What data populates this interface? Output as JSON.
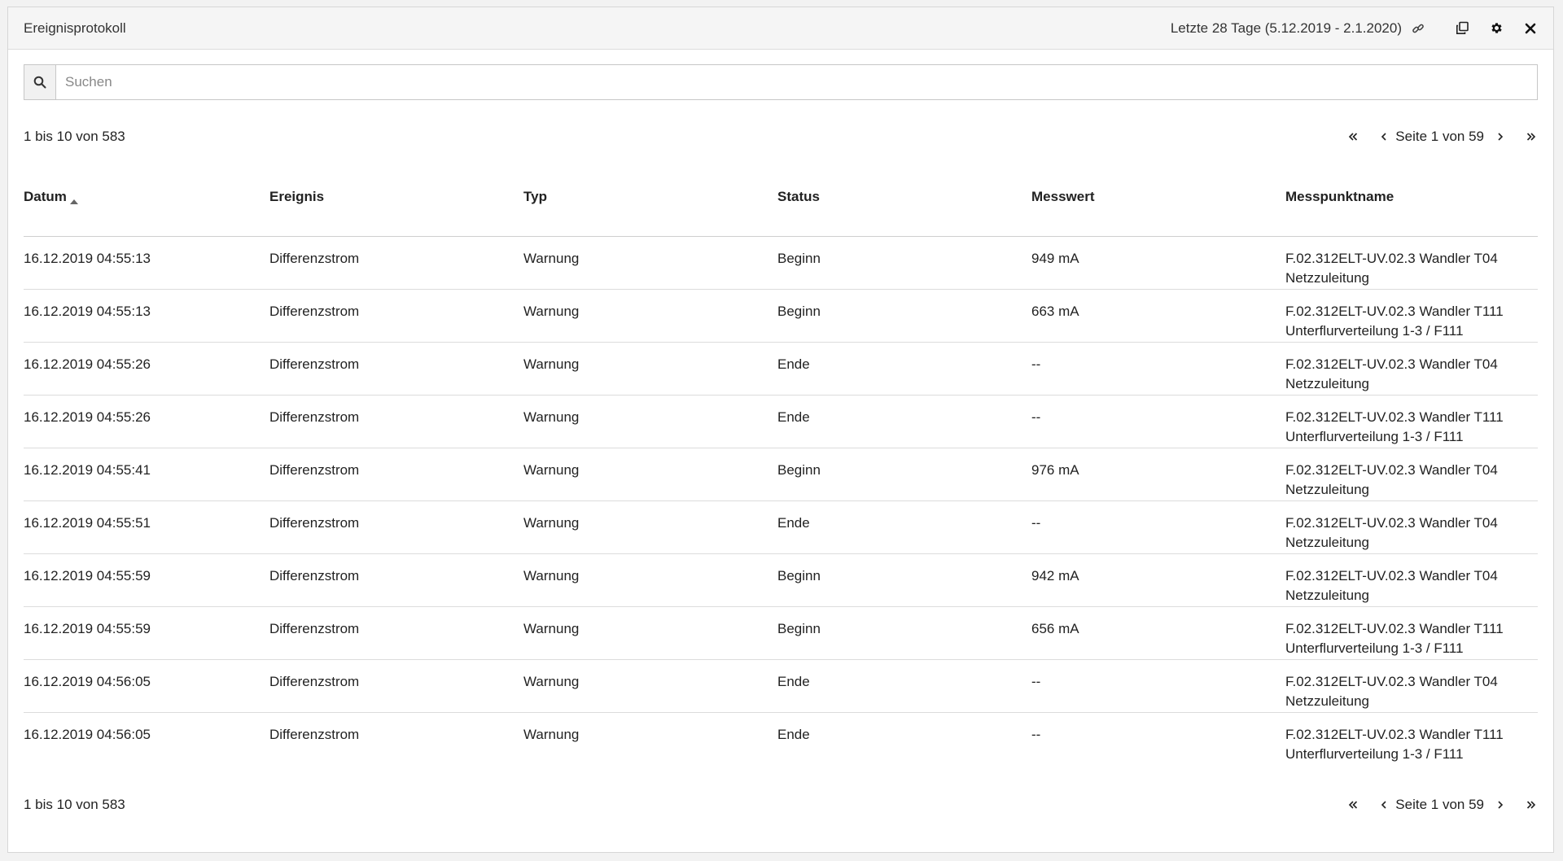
{
  "header": {
    "title": "Ereignisprotokoll",
    "range": "Letzte 28 Tage (5.12.2019 - 2.1.2020)",
    "icons": [
      "link-icon",
      "copy-icon",
      "gear-icon",
      "close-icon"
    ]
  },
  "search": {
    "placeholder": "Suchen",
    "value": ""
  },
  "pagination": {
    "summary": "1 bis 10 von 583",
    "page_text": "Seite 1 von 59"
  },
  "table": {
    "columns": [
      "Datum",
      "Ereignis",
      "Typ",
      "Status",
      "Messwert",
      "Messpunktname"
    ],
    "sorted_column": "Datum",
    "sort_direction": "asc",
    "rows": [
      [
        "16.12.2019 04:55:13",
        "Differenzstrom",
        "Warnung",
        "Beginn",
        "949 mA",
        "F.02.312ELT-UV.02.3 Wandler T04",
        "Netzzuleitung"
      ],
      [
        "16.12.2019 04:55:13",
        "Differenzstrom",
        "Warnung",
        "Beginn",
        "663 mA",
        "F.02.312ELT-UV.02.3 Wandler T111",
        "Unterflurverteilung 1-3 / F111"
      ],
      [
        "16.12.2019 04:55:26",
        "Differenzstrom",
        "Warnung",
        "Ende",
        "--",
        "F.02.312ELT-UV.02.3 Wandler T04",
        "Netzzuleitung"
      ],
      [
        "16.12.2019 04:55:26",
        "Differenzstrom",
        "Warnung",
        "Ende",
        "--",
        "F.02.312ELT-UV.02.3 Wandler T111",
        "Unterflurverteilung 1-3 / F111"
      ],
      [
        "16.12.2019 04:55:41",
        "Differenzstrom",
        "Warnung",
        "Beginn",
        "976 mA",
        "F.02.312ELT-UV.02.3 Wandler T04",
        "Netzzuleitung"
      ],
      [
        "16.12.2019 04:55:51",
        "Differenzstrom",
        "Warnung",
        "Ende",
        "--",
        "F.02.312ELT-UV.02.3 Wandler T04",
        "Netzzuleitung"
      ],
      [
        "16.12.2019 04:55:59",
        "Differenzstrom",
        "Warnung",
        "Beginn",
        "942 mA",
        "F.02.312ELT-UV.02.3 Wandler T04",
        "Netzzuleitung"
      ],
      [
        "16.12.2019 04:55:59",
        "Differenzstrom",
        "Warnung",
        "Beginn",
        "656 mA",
        "F.02.312ELT-UV.02.3 Wandler T111",
        "Unterflurverteilung 1-3 / F111"
      ],
      [
        "16.12.2019 04:56:05",
        "Differenzstrom",
        "Warnung",
        "Ende",
        "--",
        "F.02.312ELT-UV.02.3 Wandler T04",
        "Netzzuleitung"
      ],
      [
        "16.12.2019 04:56:05",
        "Differenzstrom",
        "Warnung",
        "Ende",
        "--",
        "F.02.312ELT-UV.02.3 Wandler T111",
        "Unterflurverteilung 1-3 / F111"
      ]
    ]
  }
}
